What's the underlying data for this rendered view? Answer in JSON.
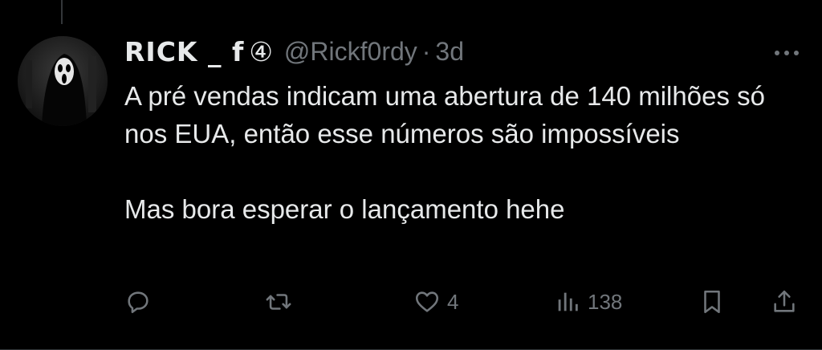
{
  "tweet": {
    "author": {
      "display_name": "RICK _ f",
      "badge": "④",
      "handle": "@Rickf0rdy",
      "separator": "·",
      "time": "3d"
    },
    "text": {
      "paragraph1": "A pré vendas indicam uma abertura de 140 milhões só nos EUA, então esse números são impossíveis",
      "paragraph2": "Mas bora esperar o lançamento hehe"
    },
    "actions": {
      "reply_icon": "reply-icon",
      "retweet_icon": "retweet-icon",
      "like_icon": "heart-icon",
      "like_count": "4",
      "views_icon": "views-icon",
      "views_count": "138",
      "bookmark_icon": "bookmark-icon",
      "share_icon": "share-icon"
    },
    "colors": {
      "background": "#000000",
      "text": "#e7e9ea",
      "muted": "#71767b"
    }
  }
}
